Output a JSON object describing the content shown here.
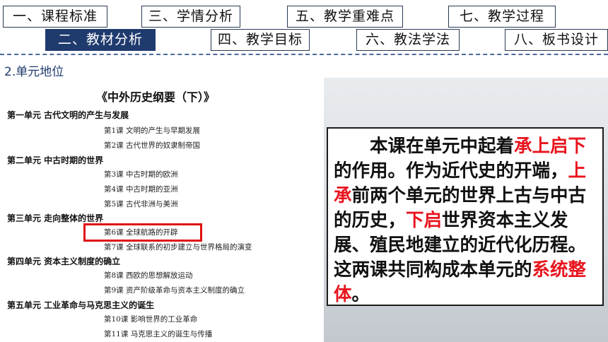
{
  "nav": {
    "items": [
      {
        "label": "一、课程标准"
      },
      {
        "label": "二、教材分析",
        "active": true
      },
      {
        "label": "三、学情分析"
      },
      {
        "label": "四、教学目标"
      },
      {
        "label": "五、教学重难点"
      },
      {
        "label": "六、教法学法"
      },
      {
        "label": "七、教学过程"
      },
      {
        "label": "八、板书设计"
      }
    ],
    "active_color": "#1f3b6e"
  },
  "section": {
    "heading": "2.单元地位"
  },
  "book": {
    "title": "《中外历史纲要（下）》",
    "units": [
      {
        "title": "第一单元  古代文明的产生与发展",
        "lessons": [
          "第1课 文明的产生与早期发展",
          "第2课 古代世界的奴隶制帝国"
        ]
      },
      {
        "title": "第二单元  中古时期的世界",
        "lessons": [
          "第3课 中古时期的欧洲",
          "第4课 中古时期的亚洲",
          "第5课 古代非洲与美洲"
        ]
      },
      {
        "title": "第三单元  走向整体的世界",
        "lessons": [
          "第6课 全球航路的开辟",
          "第7课 全球联系的初步建立与世界格局的演变"
        ]
      },
      {
        "title": "第四单元  资本主义制度的确立",
        "lessons": [
          "第8课 西欧的思想解放运动",
          "第9课 资产阶级革命与资本主义制度的确立"
        ]
      },
      {
        "title": "第五单元  工业革命与马克思主义的诞生",
        "lessons": [
          "第10课 影响世界的工业革命",
          "第11课 马克思主义的诞生与传播"
        ]
      }
    ],
    "highlighted_lesson": "第6课 全球航路的开辟",
    "highlight_color": "#e01010"
  },
  "summary": {
    "segments": [
      {
        "text": "本课在单元中起着",
        "red": false
      },
      {
        "text": "承上启下",
        "red": true
      },
      {
        "text": "的作用。作为近代史的开端，",
        "red": false
      },
      {
        "text": "上承",
        "red": true
      },
      {
        "text": "前两个单元的世界上古与中古的历史，",
        "red": false
      },
      {
        "text": "下启",
        "red": true
      },
      {
        "text": "世界资本主义发展、殖民地建立的近代化历程。这两课共同构成本单元的",
        "red": false
      },
      {
        "text": "系统整体",
        "red": true
      },
      {
        "text": "。",
        "red": false
      }
    ],
    "accent_color": "#e8141e"
  }
}
